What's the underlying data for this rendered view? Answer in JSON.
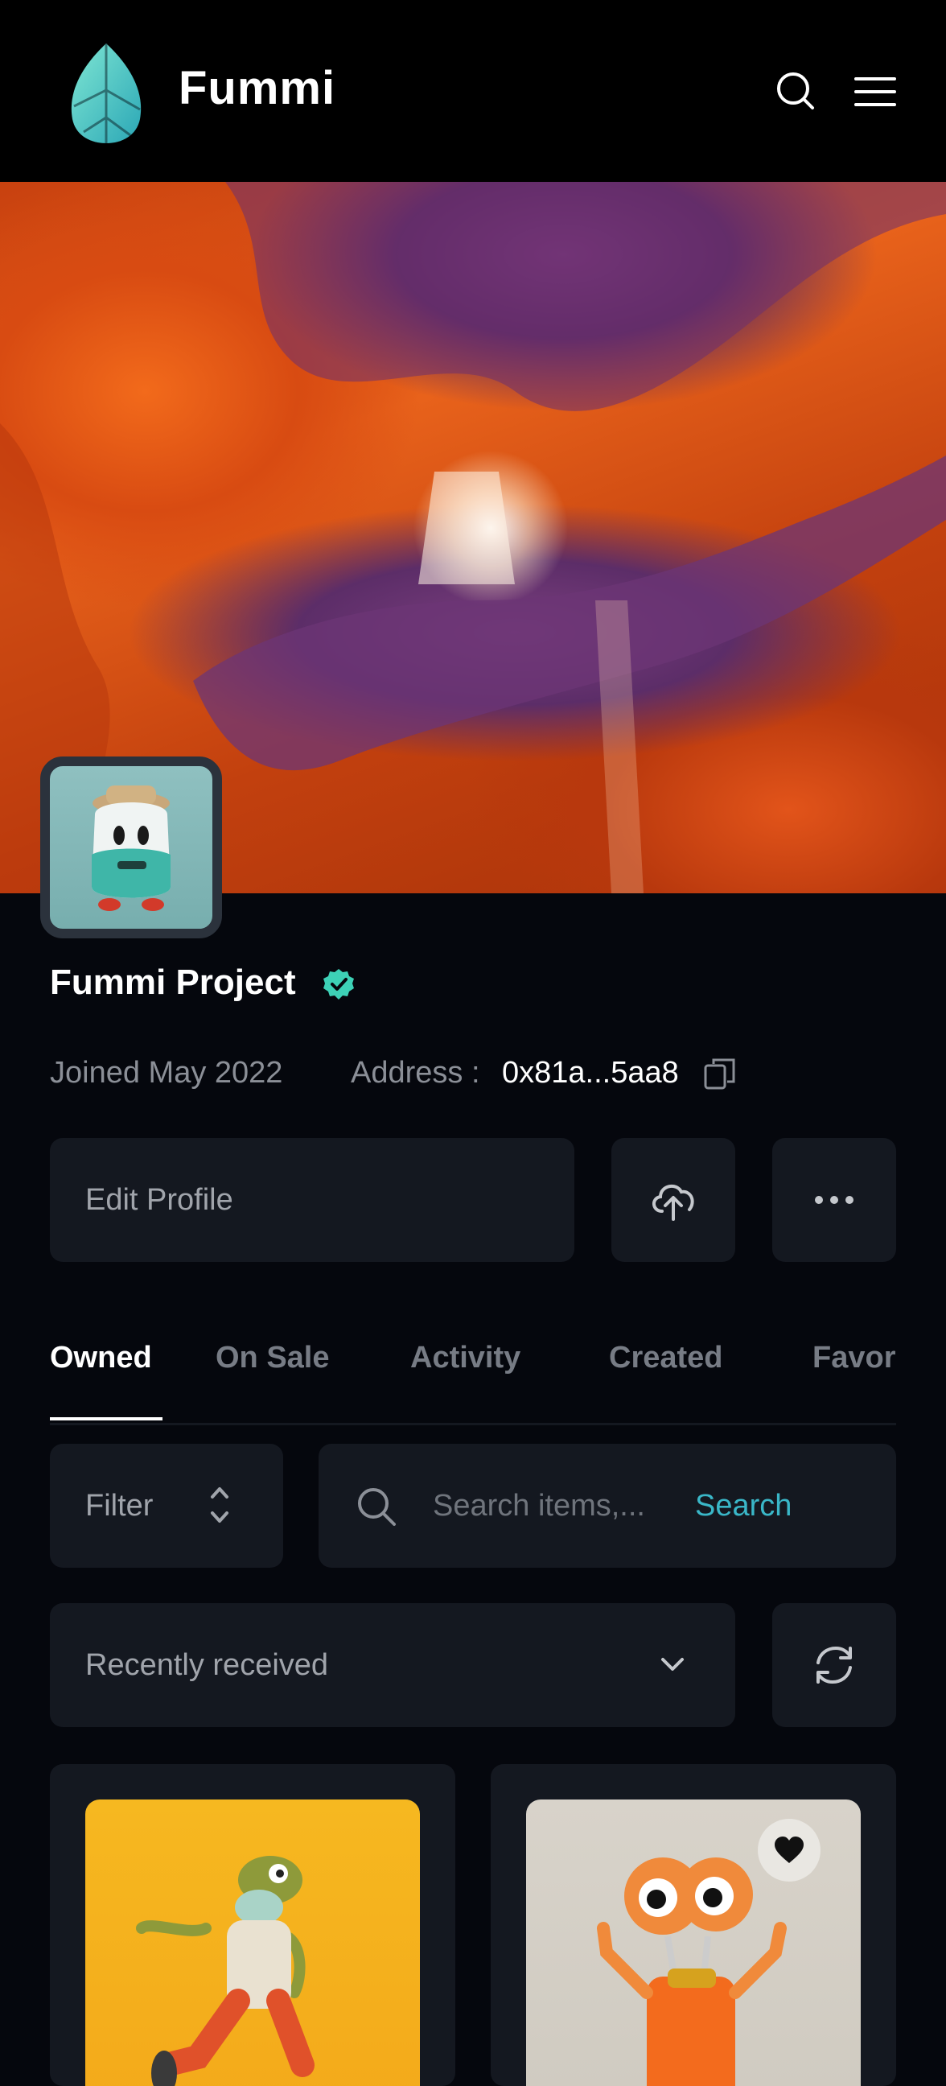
{
  "header": {
    "brand_name": "Fummi",
    "logo_icon": "leaf-gem-icon",
    "search_icon": "search-icon",
    "menu_icon": "hamburger-menu-icon"
  },
  "profile": {
    "name": "Fummi Project",
    "verified_icon": "verified-badge-icon",
    "joined": "Joined May 2022",
    "address_label": "Address :",
    "address_value": "0x81a...5aa8",
    "copy_icon": "copy-icon"
  },
  "actions": {
    "edit_profile_label": "Edit Profile",
    "upload_icon": "cloud-upload-icon",
    "more_icon": "more-dots-icon"
  },
  "tabs": [
    {
      "label": "Owned",
      "active": true
    },
    {
      "label": "On Sale",
      "active": false
    },
    {
      "label": "Activity",
      "active": false
    },
    {
      "label": "Created",
      "active": false
    },
    {
      "label": "Favor",
      "active": false
    }
  ],
  "filter": {
    "label": "Filter",
    "icon": "sort-arrows-icon"
  },
  "search": {
    "placeholder": "Search items,...",
    "button_label": "Search"
  },
  "sort": {
    "selected": "Recently received",
    "chevron_icon": "chevron-down-icon",
    "refresh_icon": "refresh-icon"
  },
  "items": [
    {
      "image": "zombie-nft-image",
      "favorite": false
    },
    {
      "image": "orange-character-nft-image",
      "favorite": true
    }
  ],
  "colors": {
    "background": "#05070d",
    "panel": "#141820",
    "accent": "#3ab7c8",
    "verified": "#3dd1b6"
  }
}
